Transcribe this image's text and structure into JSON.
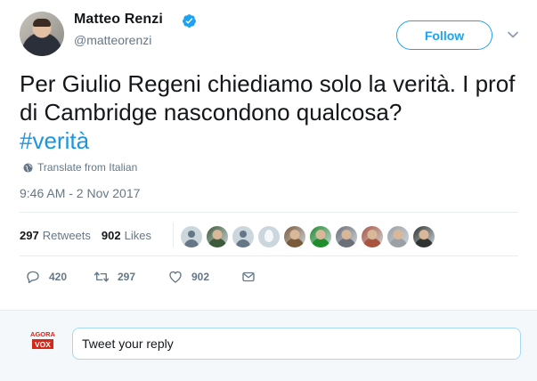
{
  "author": {
    "display_name": "Matteo Renzi",
    "screen_name": "@matteorenzi",
    "verified": true,
    "avatar_icon": "profile-photo"
  },
  "follow_button": {
    "label": "Follow"
  },
  "tweet": {
    "text": "Per Giulio Regeni chiediamo solo la verità. I prof di Cambridge nascondono qualcosa?",
    "hashtag": "#verità",
    "translate_label": "Translate from Italian",
    "timestamp": "9:46 AM - 2 Nov 2017"
  },
  "stats": {
    "retweets_count": "297",
    "retweets_label": "Retweets",
    "likes_count": "902",
    "likes_label": "Likes"
  },
  "likers": [
    {
      "type": "default"
    },
    {
      "type": "photo",
      "color": "#3d5a3a"
    },
    {
      "type": "default"
    },
    {
      "type": "egg"
    },
    {
      "type": "photo",
      "color": "#7a5a3c"
    },
    {
      "type": "photo",
      "color": "#1f8c2e"
    },
    {
      "type": "photo",
      "color": "#6b6f78"
    },
    {
      "type": "photo",
      "color": "#a8553f"
    },
    {
      "type": "photo",
      "color": "#9aa0a6"
    },
    {
      "type": "photo",
      "color": "#2f3430"
    }
  ],
  "actions": {
    "reply_count": "420",
    "retweet_count": "297",
    "like_count": "902"
  },
  "reply_box": {
    "placeholder": "Tweet your reply",
    "user_avatar_text_top": "AGORA",
    "user_avatar_text_bottom": "VOX"
  },
  "colors": {
    "accent": "#1da1f2",
    "hashtag": "#1b95e0",
    "secondary_text": "#657786",
    "divider": "#e6ecf0"
  }
}
